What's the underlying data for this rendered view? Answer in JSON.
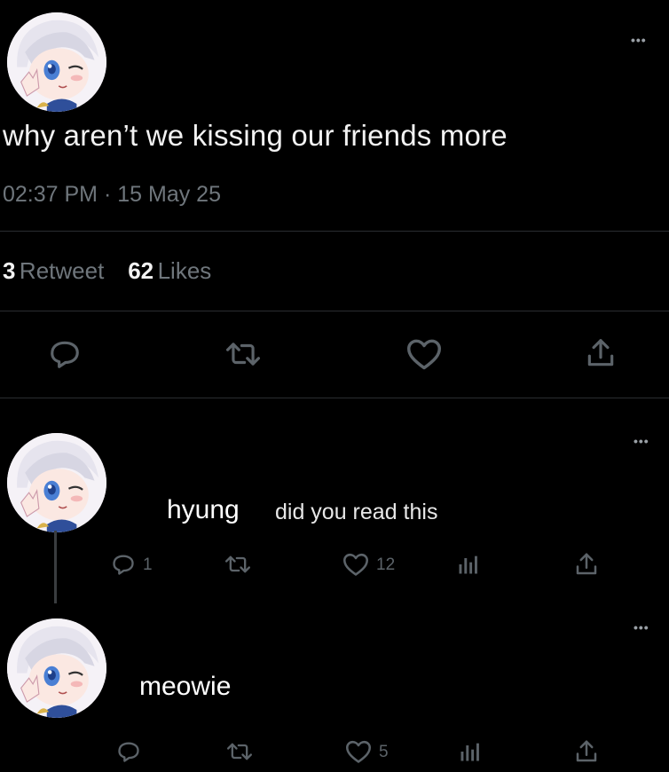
{
  "tweet": {
    "text": "why aren’t we kissing our friends more",
    "time": "02:37 PM",
    "separator": "·",
    "date": "15 May 25",
    "retweet_count": "3",
    "retweet_label": "Retweet",
    "likes_count": "62",
    "likes_label": "Likes",
    "more": "•••"
  },
  "reply1": {
    "overlay": "hyung",
    "text": "did you read this",
    "reply_count": "1",
    "like_count": "12",
    "more": "•••"
  },
  "reply2": {
    "overlay": "meowie",
    "like_count": "5",
    "more": "•••"
  },
  "colors": {
    "background": "#000000",
    "text": "#f2f2f2",
    "muted": "#6f767c",
    "icon": "#5c6369"
  },
  "icons": [
    "reply-icon",
    "retweet-icon",
    "like-icon",
    "share-icon",
    "analytics-icon",
    "more-icon"
  ]
}
